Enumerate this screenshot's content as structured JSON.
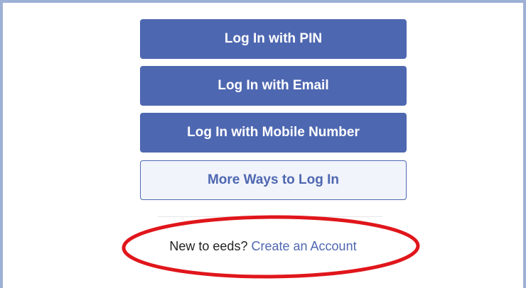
{
  "login_options": {
    "pin_label": "Log In with PIN",
    "email_label": "Log In with Email",
    "mobile_label": "Log In with Mobile Number",
    "more_label": "More Ways to Log In"
  },
  "signup": {
    "prompt": "New to eeds?",
    "link": "Create an Account"
  },
  "colors": {
    "primary": "#4e67b1",
    "secondary_bg": "#f1f4fa",
    "frame_border": "#9fb0d6",
    "annotation": "#e0161b"
  }
}
